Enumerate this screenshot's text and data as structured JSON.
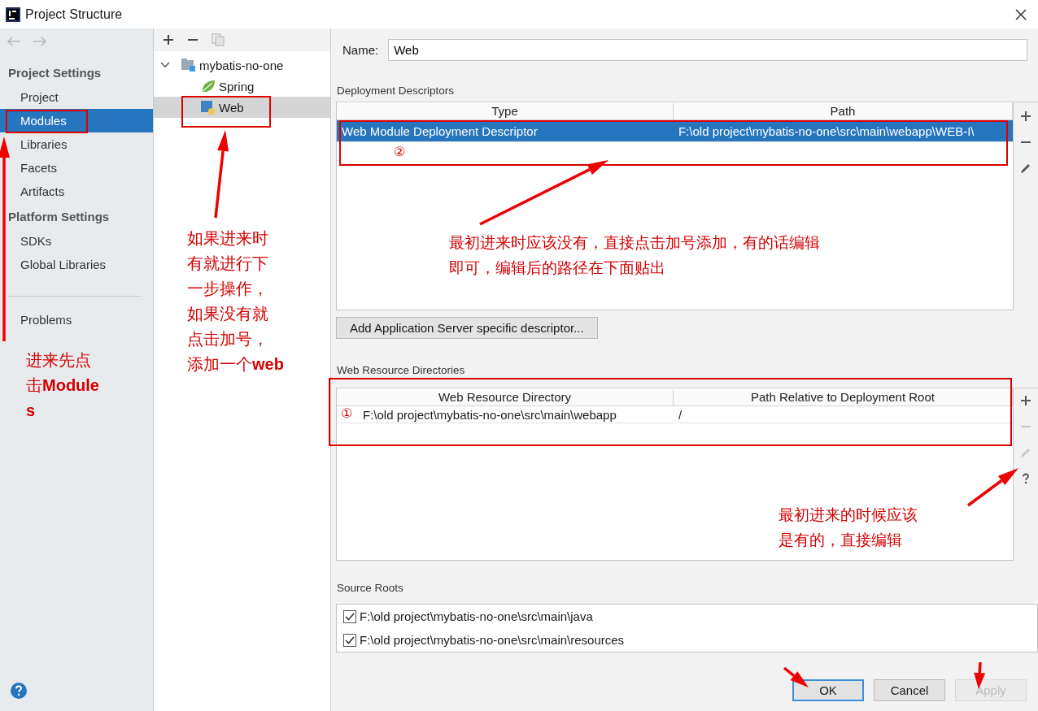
{
  "window": {
    "title": "Project Structure"
  },
  "sidebar": {
    "sections": [
      {
        "heading": "Project Settings",
        "items": [
          {
            "label": "Project",
            "selected": false
          },
          {
            "label": "Modules",
            "selected": true
          },
          {
            "label": "Libraries",
            "selected": false
          },
          {
            "label": "Facets",
            "selected": false
          },
          {
            "label": "Artifacts",
            "selected": false
          }
        ]
      },
      {
        "heading": "Platform Settings",
        "items": [
          {
            "label": "SDKs",
            "selected": false
          },
          {
            "label": "Global Libraries",
            "selected": false
          }
        ]
      },
      {
        "items": [
          {
            "label": "Problems",
            "selected": false
          }
        ]
      }
    ]
  },
  "tree": {
    "nodes": [
      {
        "label": "mybatis-no-one",
        "kind": "module",
        "expanded": true,
        "selected": false,
        "children": [
          {
            "label": "Spring",
            "kind": "spring",
            "selected": false
          },
          {
            "label": "Web",
            "kind": "web",
            "selected": true
          }
        ]
      }
    ]
  },
  "name_field": {
    "label": "Name:",
    "value": "Web"
  },
  "deployment_descriptors": {
    "title": "Deployment Descriptors",
    "columns": [
      "Type",
      "Path"
    ],
    "rows": [
      {
        "cells": [
          "Web Module Deployment Descriptor",
          "F:\\old project\\mybatis-no-one\\src\\main\\webapp\\WEB-I\\"
        ],
        "selected": true
      }
    ],
    "tools": [
      {
        "kind": "add",
        "disabled": false
      },
      {
        "kind": "remove",
        "disabled": false
      },
      {
        "kind": "edit",
        "disabled": false
      }
    ]
  },
  "add_descriptor_button": {
    "label": "Add Application Server specific descriptor..."
  },
  "web_resource_directories": {
    "title": "Web Resource Directories",
    "columns": [
      "Web Resource Directory",
      "Path Relative to Deployment Root"
    ],
    "rows": [
      {
        "cells": [
          "F:\\old project\\mybatis-no-one\\src\\main\\webapp",
          "/"
        ],
        "selected": false
      }
    ],
    "tools": [
      {
        "kind": "add",
        "disabled": false
      },
      {
        "kind": "remove",
        "disabled": true
      },
      {
        "kind": "edit",
        "disabled": true
      },
      {
        "kind": "help",
        "disabled": false
      }
    ]
  },
  "source_roots": {
    "title": "Source Roots",
    "items": [
      {
        "path": "F:\\old project\\mybatis-no-one\\src\\main\\java",
        "checked": true
      },
      {
        "path": "F:\\old project\\mybatis-no-one\\src\\main\\resources",
        "checked": true
      }
    ]
  },
  "buttons": [
    {
      "label": "OK",
      "kind": "default",
      "disabled": false
    },
    {
      "label": "Cancel",
      "kind": "normal",
      "disabled": false
    },
    {
      "label": "Apply",
      "kind": "normal",
      "disabled": true
    }
  ],
  "annotations": [
    {
      "kind": "note",
      "lines": [
        "进来先点",
        "击**Module**",
        "**s**"
      ]
    },
    {
      "kind": "note",
      "lines": [
        "如果进来时",
        "有就进行下",
        "一步操作，",
        "如果没有就",
        "点击加号，",
        "添加一个**web**"
      ]
    },
    {
      "kind": "note",
      "lines": [
        "最初进来时应该没有，直接点击加号添加，有的话编辑",
        "即可，编辑后的路径在下面贴出"
      ]
    },
    {
      "kind": "note",
      "lines": [
        "最初进来的时候应该",
        "是有的，直接编辑"
      ]
    },
    {
      "kind": "marker",
      "text": "②"
    },
    {
      "kind": "marker",
      "text": "①"
    }
  ]
}
